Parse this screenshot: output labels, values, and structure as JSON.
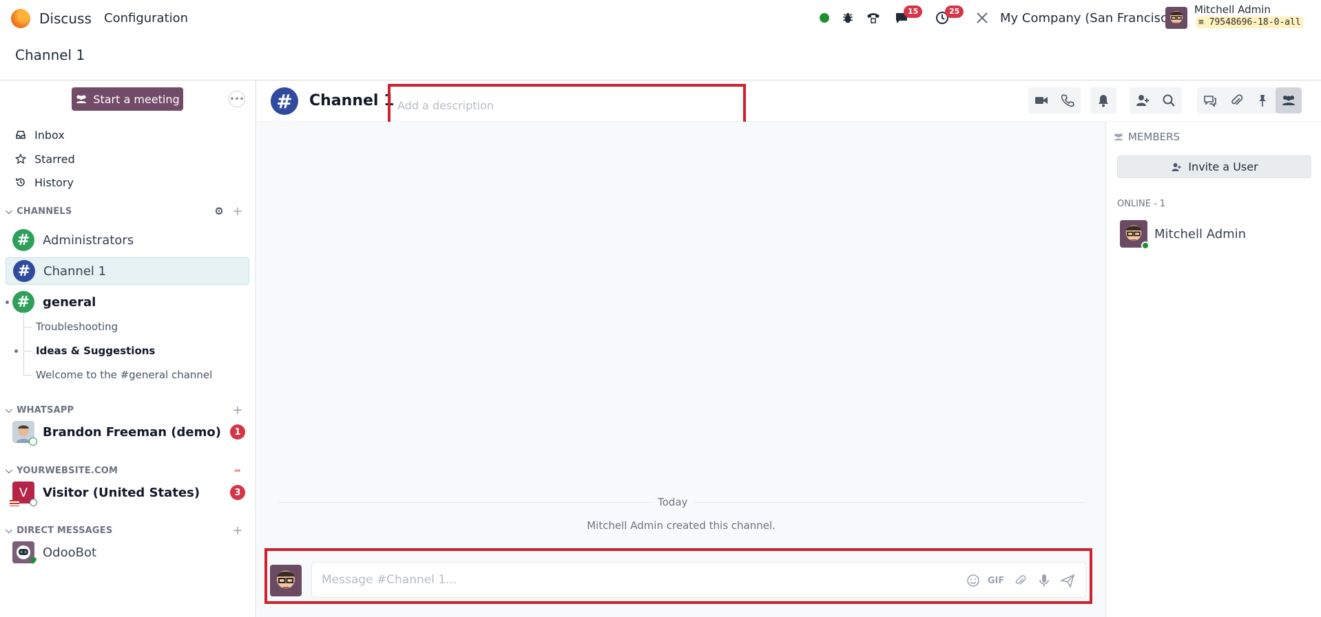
{
  "navbar": {
    "app_name": "Discuss",
    "menu_config": "Configuration",
    "messages_count": "15",
    "activities_count": "25",
    "company": "My Company (San Francisco)",
    "user_name": "Mitchell Admin",
    "db_name": "79548696-18-0-all"
  },
  "breadcrumb": "Channel 1",
  "sidebar": {
    "start_meeting": "Start a meeting",
    "mailboxes": [
      "Inbox",
      "Starred",
      "History"
    ],
    "categories": {
      "channels": "CHANNELS",
      "whatsapp": "WHATSAPP",
      "website": "YOURWEBSITE.COM",
      "direct": "DIRECT MESSAGES"
    },
    "channels": [
      {
        "label": "Administrators"
      },
      {
        "label": "Channel 1"
      },
      {
        "label": "general"
      }
    ],
    "sub_threads": [
      "Troubleshooting",
      "Ideas & Suggestions",
      "Welcome to the #general channel"
    ],
    "whatsapp": {
      "label": "Brandon Freeman (demo)",
      "counter": "1"
    },
    "visitor": {
      "label": "Visitor (United States)",
      "counter": "3",
      "initial": "V"
    },
    "direct": {
      "label": "OdooBot"
    }
  },
  "thread": {
    "title": "Channel 1",
    "description_placeholder": "Add a description",
    "date_separator": "Today",
    "notification": "Mitchell Admin created this channel.",
    "composer_placeholder": "Message #Channel 1...",
    "gif_label": "GIF"
  },
  "members": {
    "title": "MEMBERS",
    "invite": "Invite a User",
    "online_label": "ONLINE - 1",
    "list": [
      "Mitchell Admin"
    ]
  },
  "colors": {
    "brand": "#714b67",
    "highlight": "#d0202e",
    "online": "#1e8f2e",
    "badge": "#d63447"
  }
}
